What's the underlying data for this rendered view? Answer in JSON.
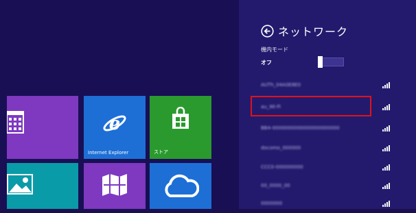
{
  "tiles": {
    "ie_label": "Internet Explorer",
    "store_label": "ストア"
  },
  "network_panel": {
    "title": "ネットワーク",
    "airplane_mode": {
      "label": "機内モード",
      "value": "オフ"
    },
    "networks": [
      {
        "name": "AUTh_04A0E8E0"
      },
      {
        "name": "au_Wi-Fi"
      },
      {
        "name": "BB4-0000000000000000000000"
      },
      {
        "name": "docomo_000000"
      },
      {
        "name": "CCC0-000000000"
      },
      {
        "name": "00_0000_00"
      },
      {
        "name": "0000000"
      }
    ]
  },
  "colors": {
    "start_background": "#190f55",
    "charm_background": "#231a6e",
    "tile_purple": "#7e39c0",
    "tile_blue": "#1d6fd6",
    "tile_green": "#2a9a2e",
    "tile_teal": "#0a9ba8",
    "highlight": "#e0121b"
  }
}
